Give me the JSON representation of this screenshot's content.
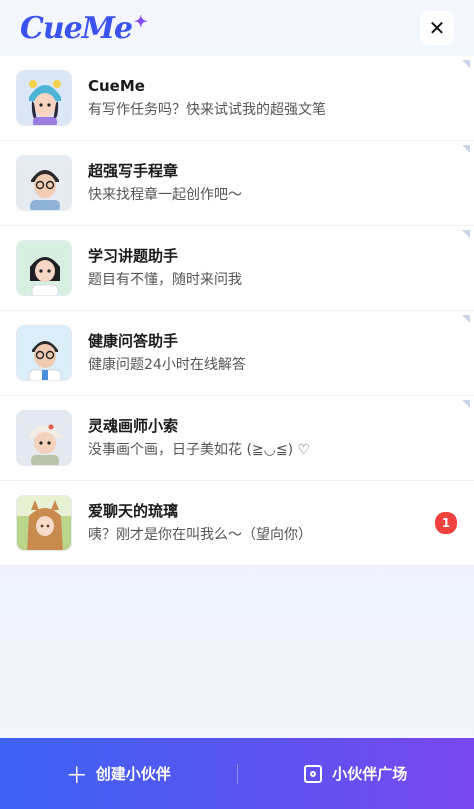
{
  "app": {
    "logo_text": "CueMe",
    "close_label": "✕"
  },
  "chats": [
    {
      "name": "CueMe",
      "desc": "有写作任务吗？快来试试我的超强文笔",
      "avatar_icon": "girl-blue-hat-avatar"
    },
    {
      "name": "超强写手程章",
      "desc": "快来找程章一起创作吧～",
      "avatar_icon": "boy-glasses-avatar"
    },
    {
      "name": "学习讲题助手",
      "desc": "题目有不懂，随时来问我",
      "avatar_icon": "girl-student-avatar"
    },
    {
      "name": "健康问答助手",
      "desc": "健康问题24小时在线解答",
      "avatar_icon": "doctor-avatar"
    },
    {
      "name": "灵魂画师小索",
      "desc": "没事画个画，日子美如花 (≧◡≦) ♡",
      "avatar_icon": "boy-cap-avatar"
    },
    {
      "name": "爱聊天的琉璃",
      "desc": "咦？刚才是你在叫我么～（望向你）",
      "avatar_icon": "anime-girl-avatar",
      "badge": "1"
    }
  ],
  "footer": {
    "create_label": "创建小伙伴",
    "plaza_label": "小伙伴广场"
  }
}
